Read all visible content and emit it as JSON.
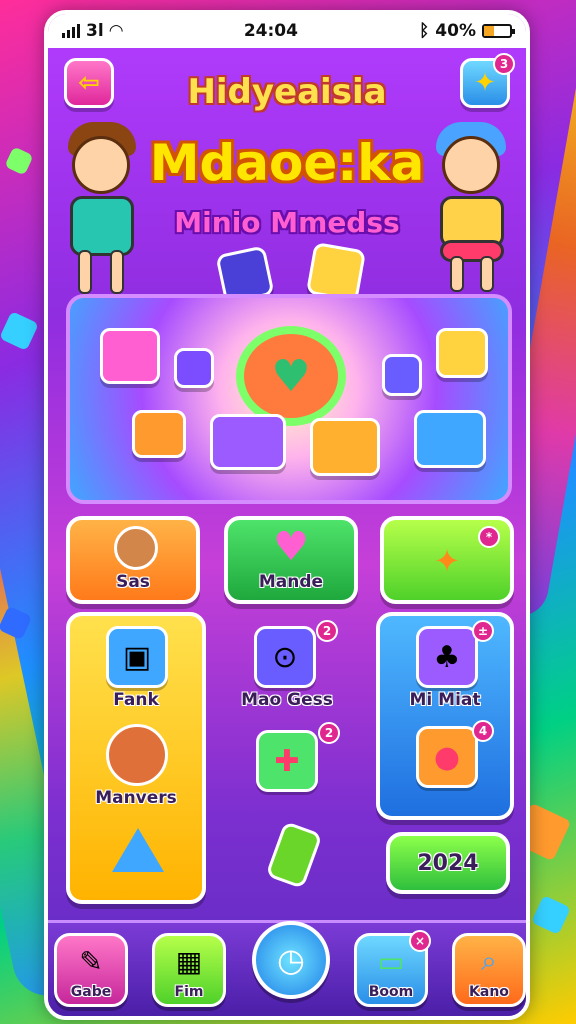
{
  "status_bar": {
    "carrier": "3l",
    "time": "24:04",
    "battery_text": "40%",
    "battery_level": 0.4
  },
  "header": {
    "title_line1": "Hidyeaisia",
    "title_line2": "Mdaoe:ka",
    "subtitle": "Minio Mmedss",
    "gift_badge": "3"
  },
  "tiles": {
    "top_left_label": "Sas",
    "top_mid_label": "Mande",
    "top_right_badge": "*",
    "left_col": {
      "item1_label": "Fank",
      "item2_label": "Manvers"
    },
    "mid_col": {
      "item1_label": "Mao Gess",
      "item1_badge": "2",
      "item2_badge": "2"
    },
    "right_col": {
      "item1_label": "Mi Miat",
      "item1_badge": "±",
      "item2_badge": "4"
    },
    "score_button": "2024"
  },
  "bottom_nav": {
    "items": [
      {
        "label": "Gabe"
      },
      {
        "label": "Fim"
      },
      {
        "label": "Boom",
        "badge": "×"
      },
      {
        "label": "Kano"
      }
    ]
  },
  "colors": {
    "accent_yellow": "#ffe600",
    "accent_pink": "#ff5fd0",
    "primary_purple": "#8f2de0"
  }
}
